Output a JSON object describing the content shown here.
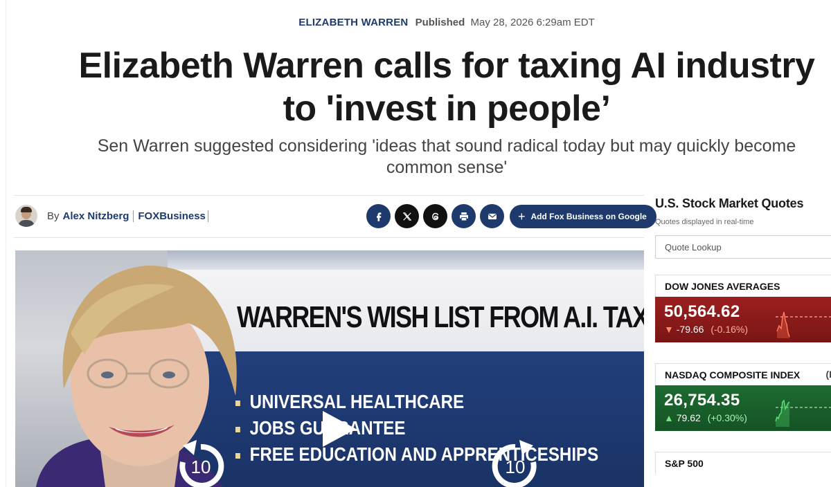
{
  "article": {
    "author_tag": "ELIZABETH WARREN",
    "published_label": "Published",
    "published_date": "May 28, 2026 6:29am EDT",
    "headline": "Elizabeth Warren calls for taxing AI industry to 'invest in people’",
    "subheadline": "Sen Warren suggested considering 'ideas that sound radical today but may quickly become common sense'"
  },
  "byline": {
    "by_label": "By",
    "author_name": "Alex Nitzberg",
    "outlet": "FOXBusiness"
  },
  "share": {
    "facebook_icon": "facebook-icon",
    "x_icon": "x-icon",
    "threads_icon": "threads-icon",
    "print_icon": "print-icon",
    "email_icon": "email-icon",
    "add_google_label": "Add Fox Business on Google"
  },
  "video": {
    "graphic_title": "WARREN'S WISH LIST FROM A.I. TAXES",
    "bullets": [
      "UNIVERSAL HEALTHCARE",
      "JOBS GUARANTEE",
      "FREE EDUCATION AND APPRENTICESHIPS"
    ],
    "skip_back_seconds": "10",
    "skip_forward_seconds": "10"
  },
  "sidebar": {
    "title": "U.S. Stock Market Quotes",
    "subtitle": "Quotes displayed in real-time",
    "quote_placeholder": "Quote Lookup",
    "markets": [
      {
        "name": "DOW JONES AVERAGES",
        "value": "50,564.62",
        "change": "-79.66",
        "percent": "(-0.16%)",
        "direction": "down",
        "extra": ""
      },
      {
        "name": "NASDAQ COMPOSITE INDEX",
        "value": "26,754.35",
        "change": "79.62",
        "percent": "(+0.30%)",
        "direction": "up",
        "extra": "(I"
      },
      {
        "name": "S&P 500",
        "value": "",
        "change": "",
        "percent": "",
        "direction": "",
        "extra": ""
      }
    ]
  },
  "colors": {
    "brand_navy": "#1e3a6d",
    "down_red": "#8c1a1a",
    "up_green": "#1b5e2b"
  }
}
